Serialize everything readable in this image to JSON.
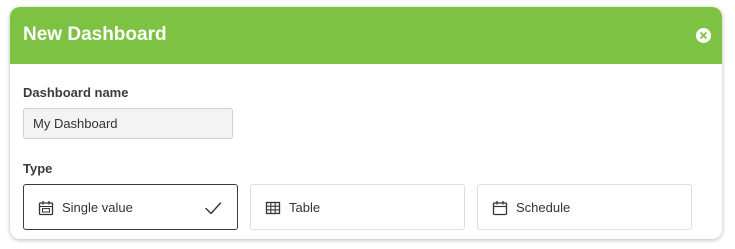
{
  "dialog": {
    "title": "New Dashboard",
    "close_icon": "close-x-circle-icon",
    "header_color": "#7dc242"
  },
  "form": {
    "name_label": "Dashboard name",
    "name_value": "My Dashboard",
    "type_label": "Type"
  },
  "types": [
    {
      "label": "Single value",
      "icon": "calendar-single-icon",
      "selected": true
    },
    {
      "label": "Table",
      "icon": "table-icon",
      "selected": false
    },
    {
      "label": "Schedule",
      "icon": "calendar-icon",
      "selected": false
    }
  ],
  "selected_icon": "checkmark-icon"
}
